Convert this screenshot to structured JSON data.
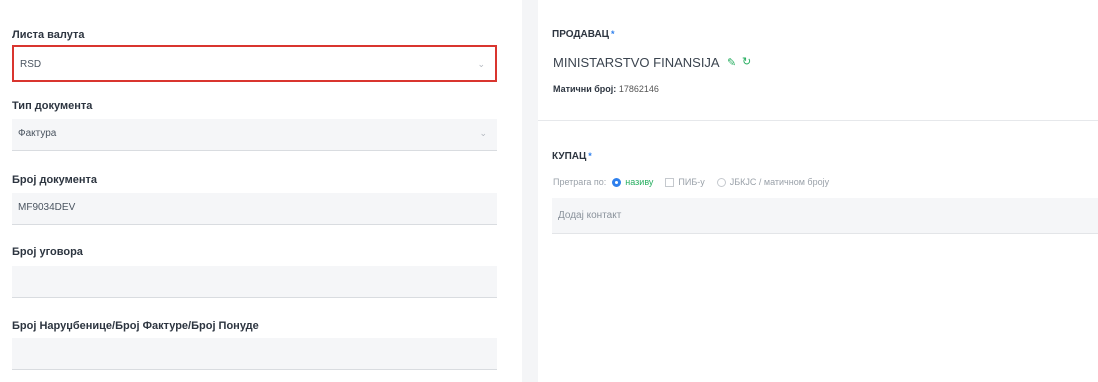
{
  "form": {
    "currency": {
      "label": "Листа валута",
      "value": "RSD"
    },
    "doc_type": {
      "label": "Тип документа",
      "value": "Фактура"
    },
    "doc_number": {
      "label": "Број документа",
      "value": "MF9034DEV"
    },
    "contract_number": {
      "label": "Број уговора",
      "value": ""
    },
    "order_number": {
      "label": "Број Наруџбенице/Број Фактуре/Број Понуде",
      "value": ""
    }
  },
  "seller": {
    "title": "ПРОДАВАЦ",
    "required_mark": "*",
    "name": "MINISTARSTVO FINANSIJA",
    "id_label": "Матични број:",
    "id_value": "17862146"
  },
  "buyer": {
    "title": "КУПАЦ",
    "required_mark": "*",
    "search_label": "Претрага по:",
    "options": [
      "називу",
      "ПИБ-у",
      "ЈБКЈС / матичном броју"
    ],
    "contact_placeholder": "Додај контакт"
  },
  "colors": {
    "active_border": "#d9352f",
    "accent_green": "#27ae60",
    "accent_blue": "#2f80ed"
  },
  "icons": {
    "edit": "pencil-icon",
    "refresh": "refresh-icon",
    "dropdown": "chevron-down-icon"
  }
}
